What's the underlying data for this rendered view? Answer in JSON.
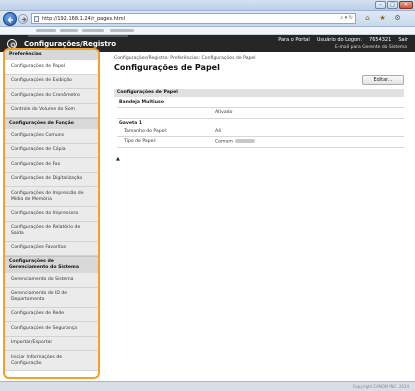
{
  "browser": {
    "url": "http://192.168.1.24/r_pages.html",
    "window_buttons": [
      "–",
      "□",
      "✕"
    ]
  },
  "topbar": {
    "app_title": "Configurações/Registro",
    "links": [
      "Para o Portal",
      "Usuário do Logon:",
      "7654321",
      "Sair"
    ],
    "email_link": "E-mail para Gerente do Sistema"
  },
  "sidebar": {
    "sections": [
      {
        "title": "Preferências",
        "items": [
          {
            "label": "Configurações de Papel",
            "active": true
          },
          {
            "label": "Configurações de Exibição"
          },
          {
            "label": "Configurações do Cronômetro"
          },
          {
            "label": "Controle do Volume do Som"
          }
        ]
      },
      {
        "title": "Configurações de Função",
        "items": [
          {
            "label": "Configurações Comuns"
          },
          {
            "label": "Configurações de Cópia"
          },
          {
            "label": "Configurações de Fax"
          },
          {
            "label": "Configurações de Digitalização"
          },
          {
            "label": "Configurações de Impressão de Mídia de Memória"
          },
          {
            "label": "Configurações da Impressora"
          },
          {
            "label": "Configurações de Relatório de Saída"
          },
          {
            "label": "Configurações Favoritas"
          }
        ]
      },
      {
        "title": "Configurações de Gerenciamento do Sistema",
        "items": [
          {
            "label": "Gerenciamento do Sistema"
          },
          {
            "label": "Gerenciamento de ID de Departamento"
          },
          {
            "label": "Configurações de Rede"
          },
          {
            "label": "Configurações de Segurança"
          },
          {
            "label": "Importar/Exportar"
          },
          {
            "label": "Iniciar Informações de Configuração"
          }
        ]
      }
    ]
  },
  "main": {
    "breadcrumb": "Configurações/Registro: Preferências: Configurações de Papel",
    "title": "Configurações de Papel",
    "edit_button": "Editar...",
    "section_title": "Configurações de Papel",
    "bandeja": {
      "heading": "Bandeja Multiuso",
      "value": "Ativado"
    },
    "gaveta": {
      "heading": "Gaveta 1",
      "size_label": "Tamanho do Papel:",
      "size_value": "A4",
      "type_label": "Tipo de Papel:",
      "type_value": "Comum"
    },
    "to_top": "▲"
  },
  "footer": {
    "copyright": "Copyright CANON INC. 2014"
  }
}
